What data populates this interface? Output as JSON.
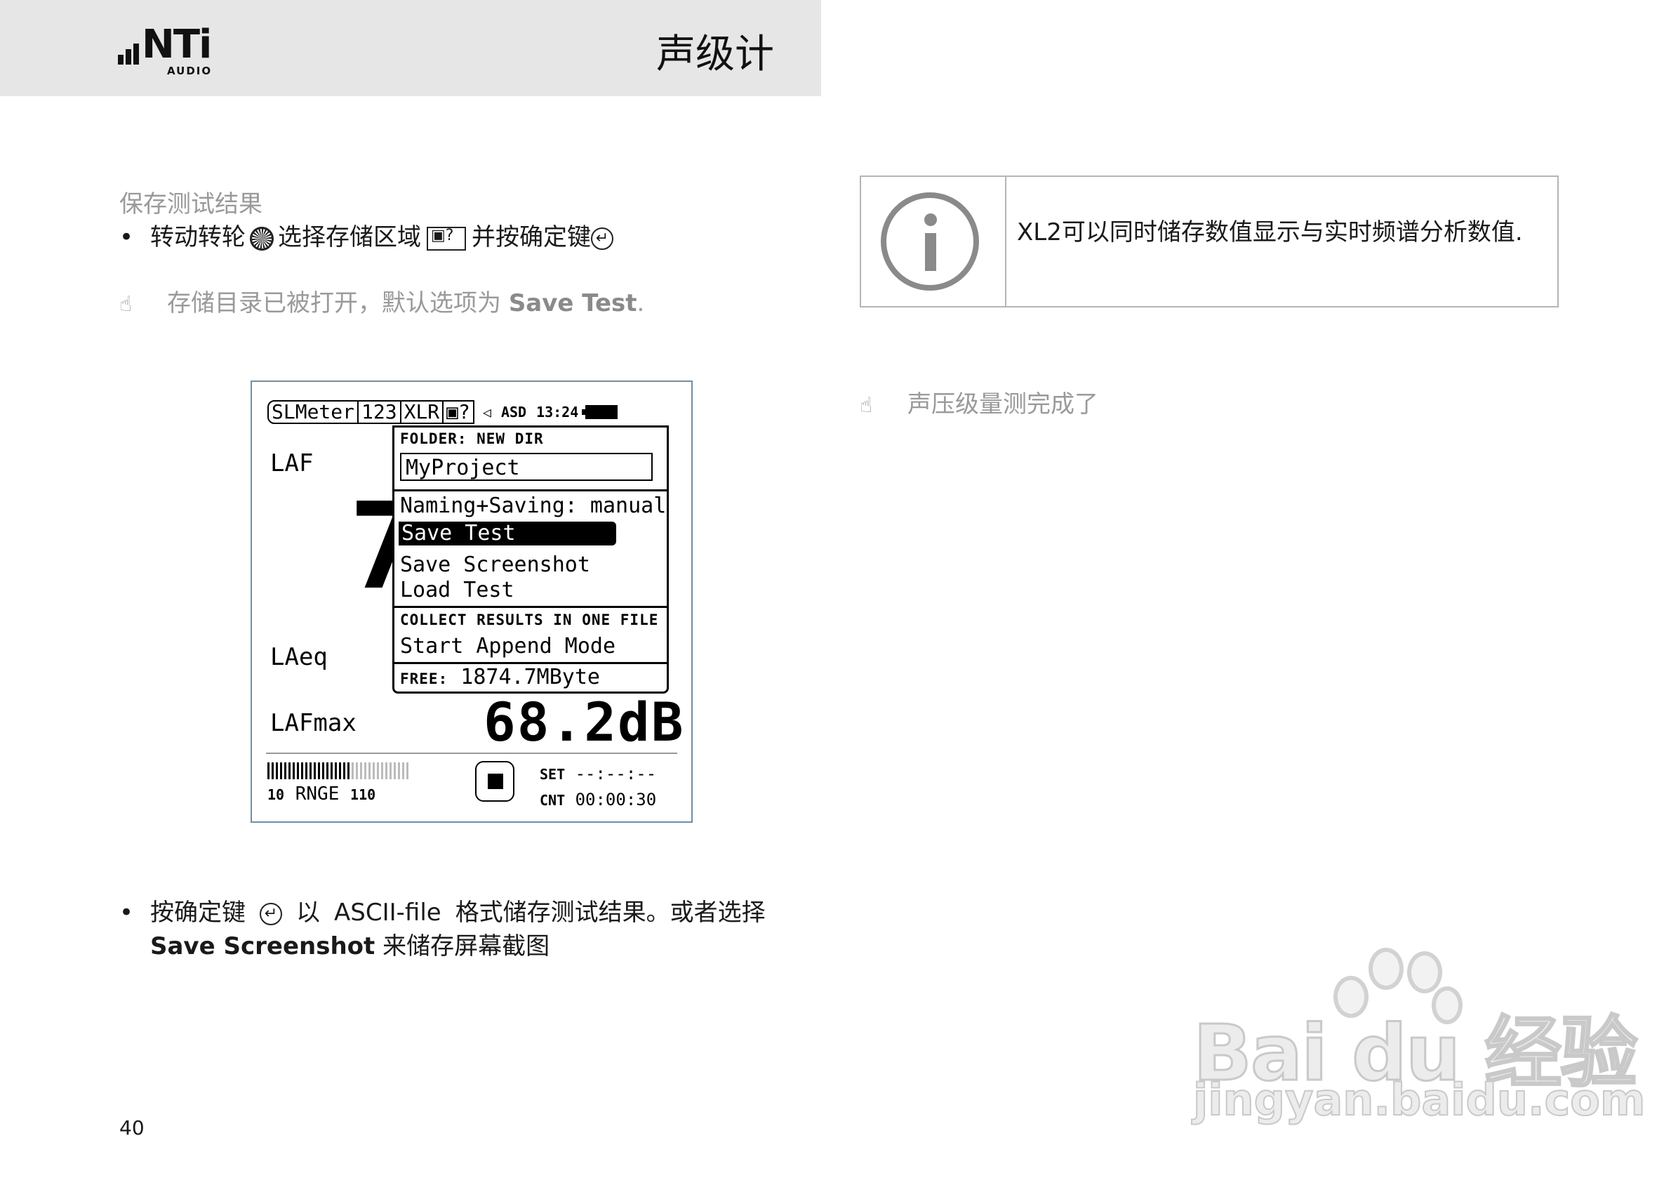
{
  "header": {
    "logo_text": "NTi",
    "logo_sub": "AUDIO",
    "title": "声级计"
  },
  "left": {
    "section_title": "保存测试结果",
    "bullet1": {
      "part1": "转动转轮",
      "part2": "选择存储区域",
      "part3": "并按确定键"
    },
    "note1": {
      "text": "存储目录已被打开，默认选项为",
      "bold": "Save Test",
      "end": "."
    },
    "device": {
      "tabs": [
        "SLMeter",
        "123",
        "XLR",
        "?"
      ],
      "status_asd": "ASD",
      "status_time": "13:24",
      "label_laf": "LAF",
      "label_laeq": "LAeq",
      "label_lafmax": "LAFmax",
      "big_digit": "7",
      "menu": {
        "folder": "FOLDER: NEW DIR",
        "project": "MyProject",
        "naming": "Naming+Saving:  manual",
        "save_test": "Save Test",
        "save_screenshot": "Save Screenshot",
        "load_test": "Load Test",
        "collect": "COLLECT RESULTS IN ONE FILE",
        "append": "Start Append Mode",
        "free_label": "FREE:",
        "free_value": "1874.7MByte"
      },
      "lafmax_value": "68.2dB",
      "range_low": "10",
      "range_label": "RNGE",
      "range_high": "110",
      "set_label": "SET",
      "set_value": "--:--:--",
      "cnt_label": "CNT",
      "cnt_value": "00:00:30"
    },
    "bullet2": {
      "part1": "按确定键",
      "part2": "以",
      "part3": "ASCII-file",
      "part4": "格式储存测试结果。或者选择",
      "bold": "Save Screenshot",
      "part5": "来储存屏幕截图"
    },
    "page_number": "40"
  },
  "right": {
    "info_text": "XL2可以同时储存数值显示与实时频谱分析数值.",
    "note2": "声压级量测完成了"
  },
  "watermark": {
    "text": "Bai du 经验",
    "sub": "jingyan.baidu.com"
  }
}
